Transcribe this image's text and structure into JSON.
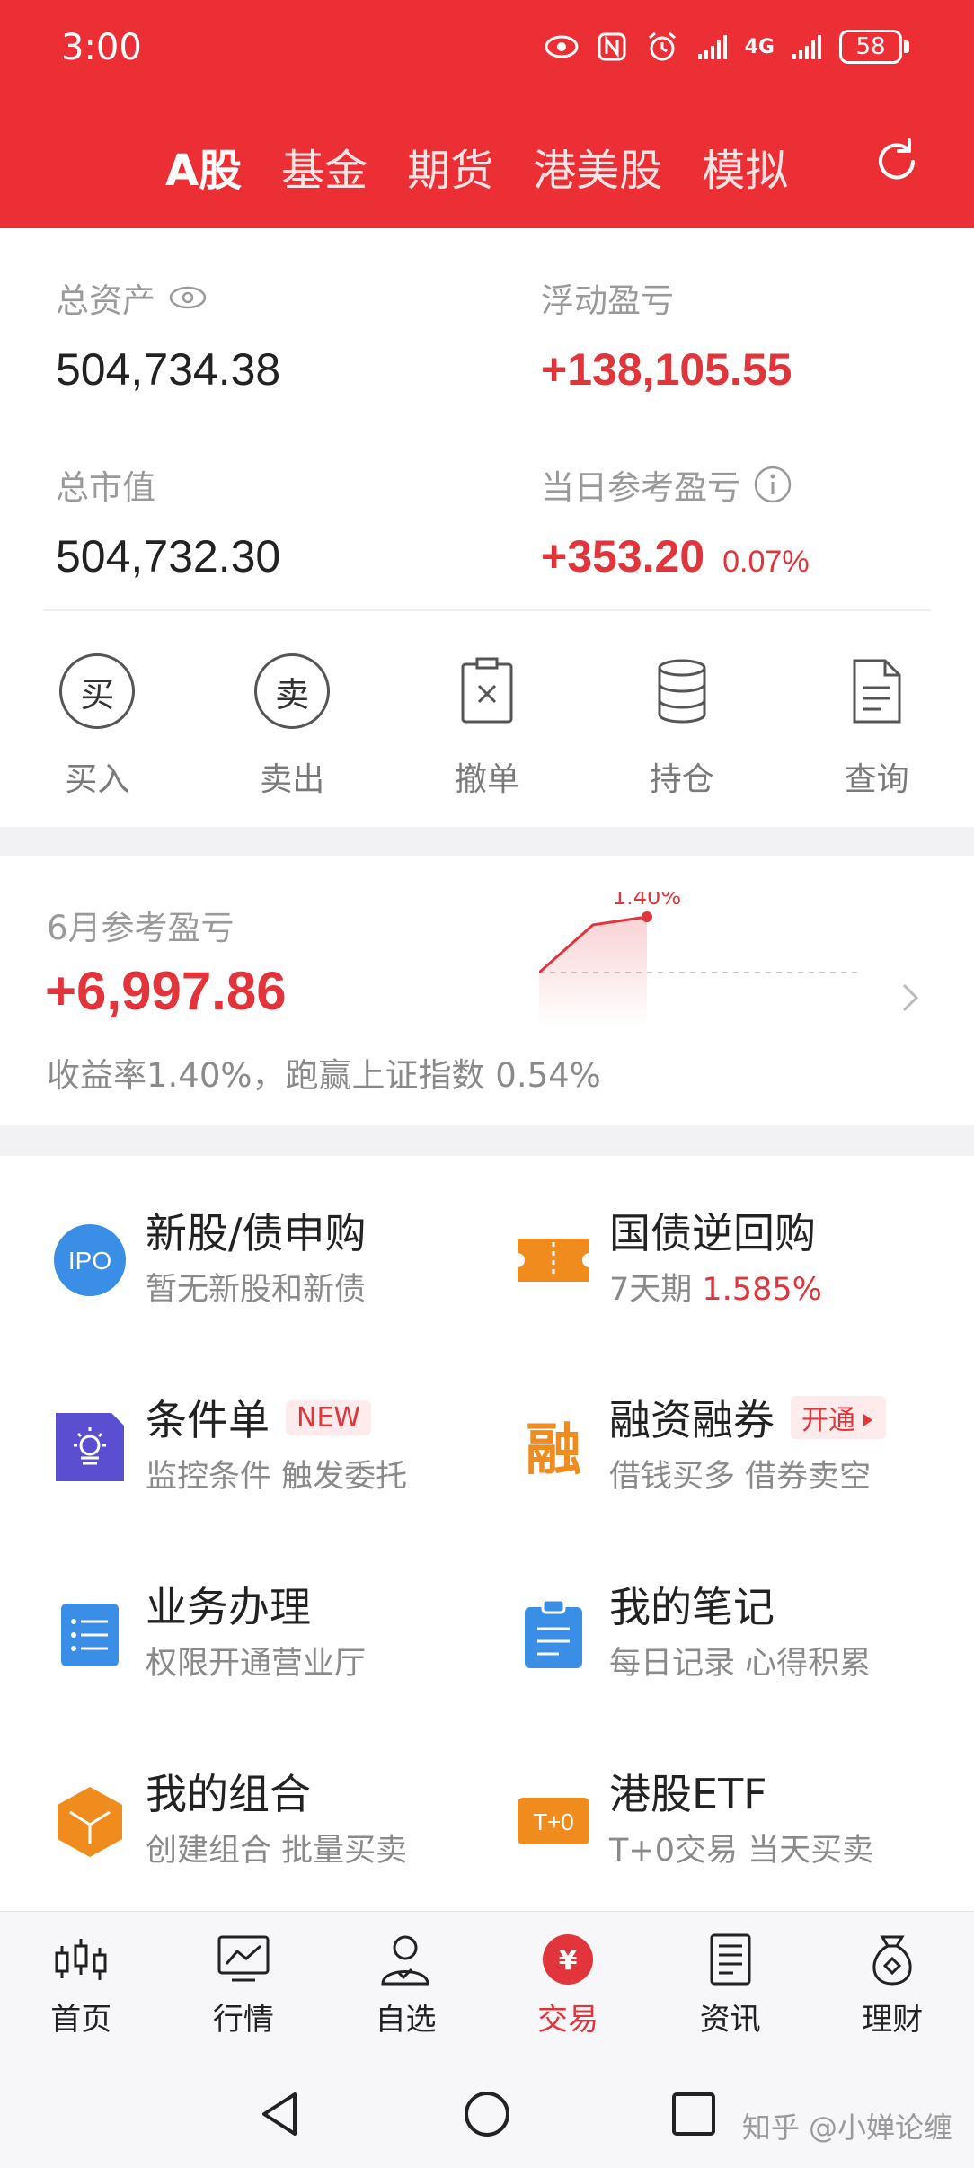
{
  "status_bar": {
    "time": "3:00",
    "network": "4G",
    "battery": "58"
  },
  "tabs": [
    {
      "label": "A股",
      "active": true
    },
    {
      "label": "基金"
    },
    {
      "label": "期货"
    },
    {
      "label": "港美股"
    },
    {
      "label": "模拟"
    }
  ],
  "assets": {
    "total_assets_label": "总资产",
    "total_assets_value": "504,734.38",
    "floating_pl_label": "浮动盈亏",
    "floating_pl_value": "+138,105.55",
    "market_value_label": "总市值",
    "market_value_value": "504,732.30",
    "daily_pl_label": "当日参考盈亏",
    "daily_pl_value": "+353.20",
    "daily_pl_pct": "0.07%"
  },
  "actions": [
    {
      "label": "买入",
      "icon": "buy-icon",
      "glyph": "买"
    },
    {
      "label": "卖出",
      "icon": "sell-icon",
      "glyph": "卖"
    },
    {
      "label": "撤单",
      "icon": "cancel-order-icon"
    },
    {
      "label": "持仓",
      "icon": "holdings-icon"
    },
    {
      "label": "查询",
      "icon": "query-icon"
    }
  ],
  "monthly": {
    "label": "6月参考盈亏",
    "value": "+6,997.86",
    "desc": "收益率1.40%，跑赢上证指数 0.54%",
    "chart_point_label": "1.40%"
  },
  "chart_data": {
    "type": "line",
    "series": [
      {
        "values": [
          0.0,
          1.2,
          1.4
        ]
      }
    ],
    "data_label": "1.40%"
  },
  "services": [
    {
      "title": "新股/债申购",
      "sub": "暂无新股和新债",
      "icon": "ipo-icon",
      "icon_text": "IPO"
    },
    {
      "title": "国债逆回购",
      "sub_prefix": "7天期 ",
      "sub_highlight": "1.585%",
      "icon": "ticket-icon"
    },
    {
      "title": "条件单",
      "tag": "NEW",
      "sub": "监控条件 触发委托",
      "icon": "condition-order-icon"
    },
    {
      "title": "融资融券",
      "tag": "开通",
      "sub": "借钱买多 借券卖空",
      "icon": "margin-icon",
      "icon_text": "融"
    },
    {
      "title": "业务办理",
      "sub": "权限开通营业厅",
      "icon": "business-icon"
    },
    {
      "title": "我的笔记",
      "sub": "每日记录 心得积累",
      "icon": "notes-icon"
    },
    {
      "title": "我的组合",
      "sub": "创建组合 批量买卖",
      "icon": "portfolio-icon"
    },
    {
      "title": "港股ETF",
      "sub": "T+0交易 当天买卖",
      "icon": "etf-icon",
      "icon_text": "T+0"
    }
  ],
  "bottom_nav": [
    {
      "label": "首页",
      "icon": "candlestick-icon"
    },
    {
      "label": "行情",
      "icon": "market-chart-icon"
    },
    {
      "label": "自选",
      "icon": "watchlist-person-icon"
    },
    {
      "label": "交易",
      "icon": "yuan-coin-icon",
      "active": true,
      "glyph": "¥"
    },
    {
      "label": "资讯",
      "icon": "news-icon"
    },
    {
      "label": "理财",
      "icon": "money-bag-icon"
    }
  ],
  "watermark": "知乎 @小婵论缠",
  "colors": {
    "brand_red": "#ec2e35",
    "profit_red": "#e2343b",
    "ipo_blue": "#3a8ee6",
    "orange": "#f08c1e",
    "purple": "#5b4fd1"
  }
}
